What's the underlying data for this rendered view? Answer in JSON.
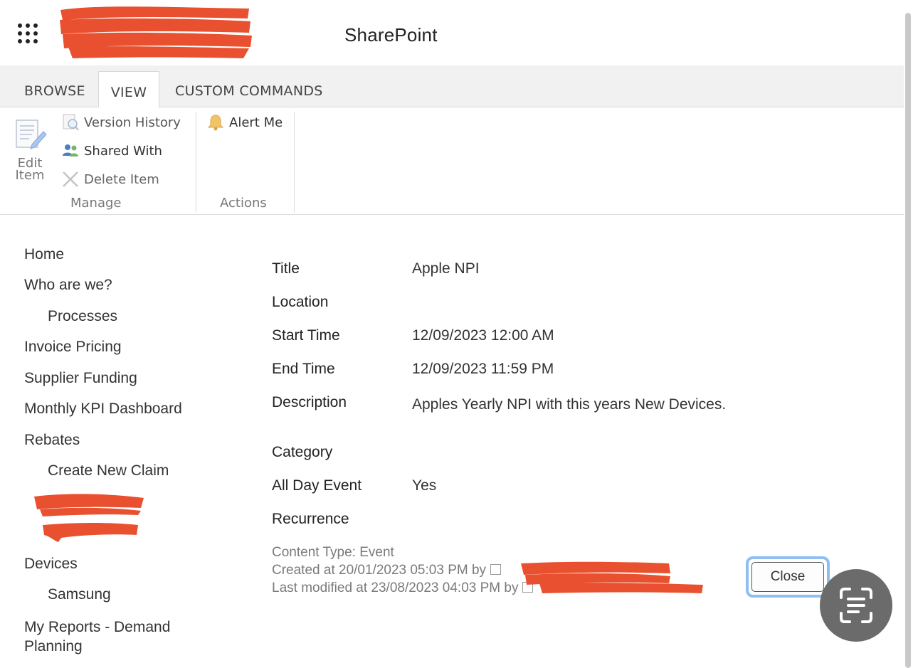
{
  "suite": {
    "brand": "SharePoint",
    "app_launcher_icon": "waffle-icon"
  },
  "ribbon": {
    "tabs": [
      {
        "label": "BROWSE"
      },
      {
        "label": "VIEW"
      },
      {
        "label": "CUSTOM COMMANDS"
      }
    ],
    "manage": {
      "edit_item": "Edit Item",
      "version_history": "Version History",
      "shared_with": "Shared With",
      "delete_item": "Delete Item",
      "group_label": "Manage"
    },
    "actions": {
      "alert_me": "Alert Me",
      "group_label": "Actions"
    }
  },
  "nav": {
    "home": "Home",
    "who_are_we": "Who are we?",
    "processes": "Processes",
    "invoice_pricing": "Invoice Pricing",
    "supplier_funding": "Supplier Funding",
    "monthly_kpi": "Monthly KPI Dashboard",
    "rebates": "Rebates",
    "create_new_claim": "Create New Claim",
    "devices": "Devices",
    "samsung": "Samsung",
    "my_reports": "My Reports - Demand Planning"
  },
  "item": {
    "fields": [
      {
        "label": "Title",
        "value": "Apple NPI"
      },
      {
        "label": "Location",
        "value": ""
      },
      {
        "label": "Start Time",
        "value": "12/09/2023 12:00 AM"
      },
      {
        "label": "End Time",
        "value": "12/09/2023 11:59 PM"
      },
      {
        "label": "Description",
        "value": "Apples Yearly NPI with this years New Devices."
      },
      {
        "label": "Category",
        "value": ""
      },
      {
        "label": "All Day Event",
        "value": "Yes"
      },
      {
        "label": "Recurrence",
        "value": ""
      }
    ],
    "content_type": "Content Type: Event",
    "created": "Created at 20/01/2023 05:03 PM by",
    "modified": "Last modified at 23/08/2023 04:03 PM by"
  },
  "close_label": "Close",
  "colors": {
    "redaction": "#e8502f",
    "focus_ring": "#8fbef2"
  }
}
